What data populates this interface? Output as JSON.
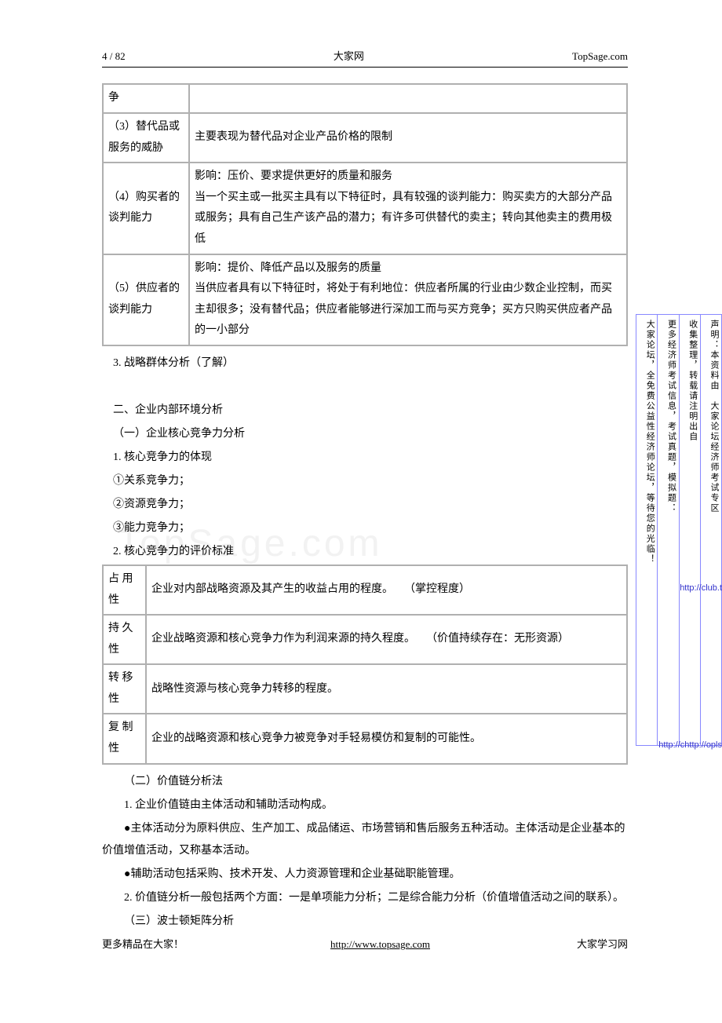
{
  "header": {
    "page_num": "4 / 82",
    "site_cn": "大家网",
    "site_en": "TopSage.com"
  },
  "table1": {
    "rows": [
      {
        "c1": "争",
        "c2": ""
      },
      {
        "c1": "（3）替代品或服务的威胁",
        "c2": "主要表现为替代品对企业产品价格的限制"
      },
      {
        "c1": "（4）购买者的谈判能力",
        "c2": "影响：压价、要求提供更好的质量和服务\n当一个买主或一批买主具有以下特征时，具有较强的谈判能力：购买卖方的大部分产品或服务；具有自己生产该产品的潜力；有许多可供替代的卖主；转向其他卖主的费用极低"
      },
      {
        "c1": "（5）供应者的谈判能力",
        "c2": "影响：提价、降低产品以及服务的质量\n当供应者具有以下特征时，将处于有利地位：供应者所属的行业由少数企业控制，而买主却很多；没有替代品；供应者能够进行深加工而与买方竞争；买方只购买供应者产品的一小部分"
      }
    ]
  },
  "body": {
    "p1": "3. 战略群体分析（了解）",
    "p2": "二、企业内部环境分析",
    "p3": "（一）企业核心竞争力分析",
    "p4": "1. 核心竞争力的体现",
    "p5": "①关系竞争力；",
    "p6": "②资源竞争力；",
    "p7": "③能力竞争力；",
    "p8": "2. 核心竞争力的评价标准"
  },
  "table2": {
    "rows": [
      {
        "c1": "占 用性",
        "c2": "企业对内部战略资源及其产生的收益占用的程度。　　（掌控程度）"
      },
      {
        "c1": "持 久性",
        "c2": "企业战略资源和核心竞争力作为利润来源的持久程度。　　（价值持续存在：无形资源）"
      },
      {
        "c1": "转 移性",
        "c2": "战略性资源与核心竞争力转移的程度。"
      },
      {
        "c1": "复 制性",
        "c2": "企业的战略资源和核心竞争力被竞争对手轻易模仿和复制的可能性。"
      }
    ]
  },
  "body2": {
    "p1": "（二）价值链分析法",
    "p2": "1. 企业价值链由主体活动和辅助活动构成。",
    "p3": "●主体活动分为原料供应、生产加工、成品储运、市场营销和售后服务五种活动。主体活动是企业基本的价值增值活动，又称基本活动。",
    "p4": "●辅助活动包括采购、技术开发、人力资源管理和企业基础职能管理。",
    "p5": "2. 价值链分析一般包括两个方面：一是单项能力分析；二是综合能力分析（价值增值活动之间的联系）。",
    "p6": "（三）波士顿矩阵分析"
  },
  "footer": {
    "left": "更多精品在大家！",
    "center_url": "http://www.topsage.com",
    "right": "大家学习网"
  },
  "watermark": "TopSage.com",
  "side": {
    "col1": "声明：本资料由　大家论坛经济师考试专区",
    "col2": "收集整理，转载请注明出自",
    "col3": "更多经济师考试信息，考试真题，模拟题：",
    "col4": "大家论坛，全免费公益性经济师论坛，等待您的光临！",
    "link1": "http://club.t",
    "link2": "http://chttp://opls"
  }
}
